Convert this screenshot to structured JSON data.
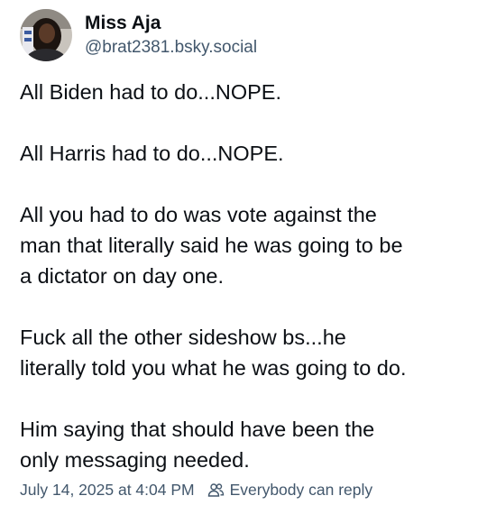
{
  "post": {
    "author": {
      "display_name": "Miss Aja",
      "handle": "@brat2381.bsky.social",
      "avatar_icon": "profile-photo"
    },
    "paragraphs": [
      "All Biden had to do...NOPE.",
      "All Harris had to do...NOPE.",
      "All you had to do was vote against the\nman that literally said he was going to be\na dictator on day one.",
      "Fuck all the other sideshow bs...he\nliterally told you what he was going to do.",
      "Him saying that should have been the\nonly messaging needed."
    ],
    "timestamp": "July 14, 2025 at 4:04 PM",
    "reply_setting": {
      "icon": "people-icon",
      "label": "Everybody can reply"
    }
  },
  "colors": {
    "text": "#0b0f14",
    "secondary": "#42576c",
    "background": "#ffffff"
  }
}
